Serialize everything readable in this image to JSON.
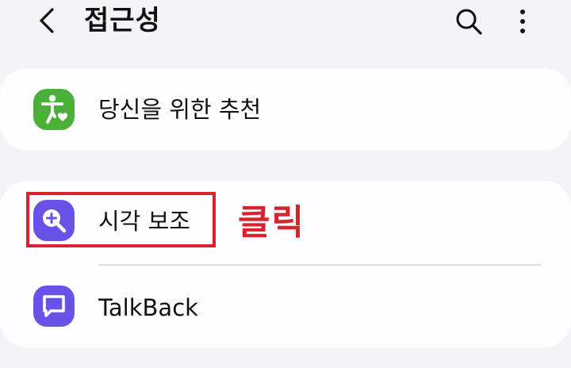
{
  "header": {
    "title": "접근성",
    "back_icon": "chevron-left-icon",
    "search_icon": "search-icon",
    "more_icon": "more-vertical-icon"
  },
  "sections": [
    {
      "items": [
        {
          "label": "당신을 위한 추천",
          "icon": "accessibility-person-icon",
          "icon_color": "#4bb039"
        }
      ]
    },
    {
      "items": [
        {
          "label": "시각 보조",
          "icon": "magnify-plus-icon",
          "icon_color": "#6753e8"
        },
        {
          "label": "TalkBack",
          "icon": "chat-bubble-icon",
          "icon_color": "#6753e8"
        }
      ]
    }
  ],
  "annotation": {
    "text": "클릭",
    "color": "#d9232c"
  }
}
